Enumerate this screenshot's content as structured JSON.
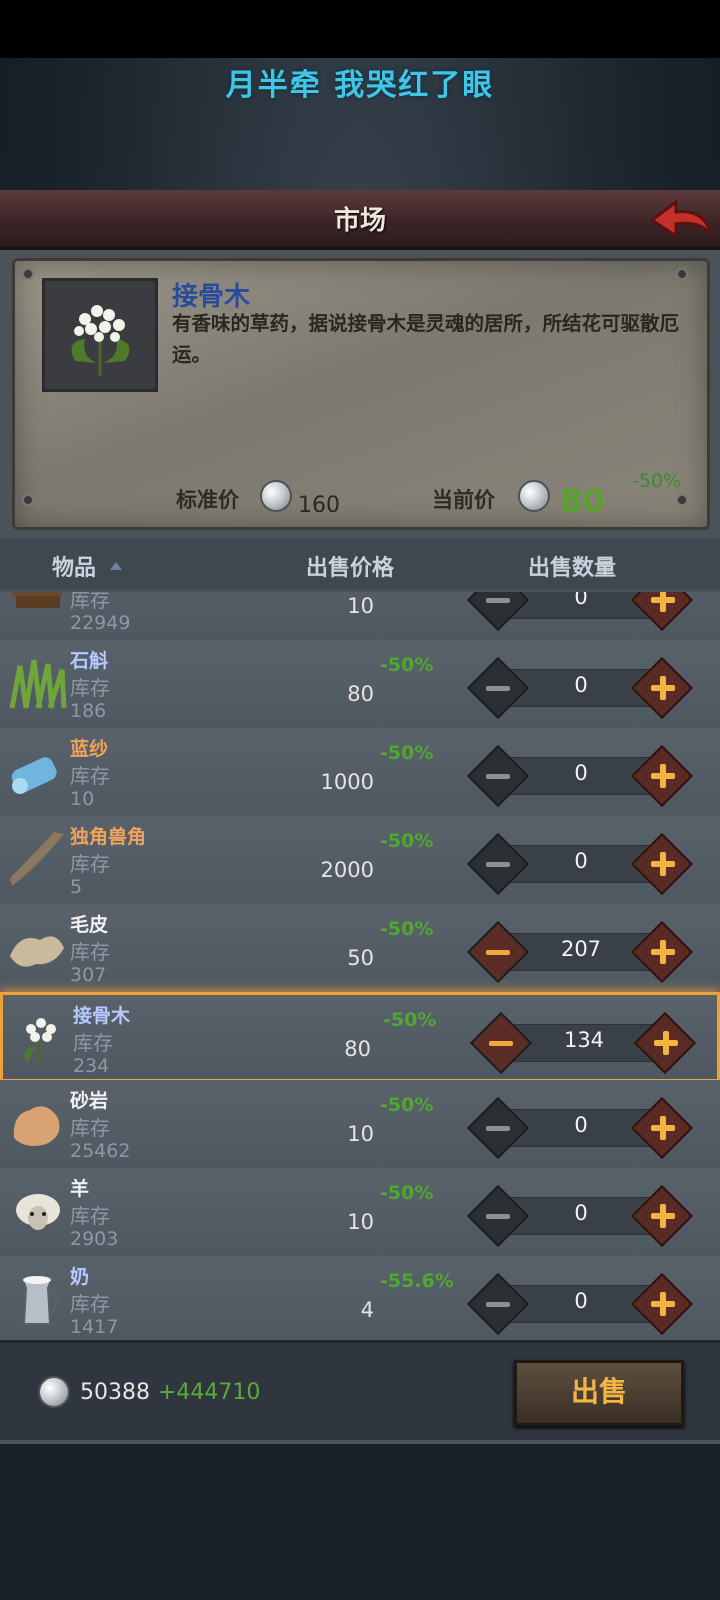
{
  "banner": {
    "text": "月半牵 我哭红了眼"
  },
  "header": {
    "title": "市场"
  },
  "detail": {
    "name": "接骨木",
    "description": "有香味的草药，据说接骨木是灵魂的居所，所结花可驱散厄运。",
    "standard_price_label": "标准价",
    "standard_price": "160",
    "current_price_label": "当前价",
    "current_price": "80",
    "discount": "-50%"
  },
  "columns": {
    "item": "物品",
    "price": "出售价格",
    "quantity": "出售数量"
  },
  "rows": [
    {
      "name": "",
      "stock_label": "库存",
      "stock": "22949",
      "discount": "",
      "price": "10",
      "qty": "0",
      "name_color": "#b6c9ff",
      "icon": "wood-icon",
      "selected": false,
      "active": false
    },
    {
      "name": "石斛",
      "stock_label": "库存",
      "stock": "186",
      "discount": "-50%",
      "price": "80",
      "qty": "0",
      "name_color": "#b6c9ff",
      "icon": "grass-icon",
      "selected": false,
      "active": false
    },
    {
      "name": "蓝纱",
      "stock_label": "库存",
      "stock": "10",
      "discount": "-50%",
      "price": "1000",
      "qty": "0",
      "name_color": "#f0a35a",
      "icon": "cloth-roll-icon",
      "selected": false,
      "active": false
    },
    {
      "name": "独角兽角",
      "stock_label": "库存",
      "stock": "5",
      "discount": "-50%",
      "price": "2000",
      "qty": "0",
      "name_color": "#f0a35a",
      "icon": "horn-icon",
      "selected": false,
      "active": false
    },
    {
      "name": "毛皮",
      "stock_label": "库存",
      "stock": "307",
      "discount": "-50%",
      "price": "50",
      "qty": "207",
      "name_color": "#f2f2f2",
      "icon": "fur-icon",
      "selected": false,
      "active": true
    },
    {
      "name": "接骨木",
      "stock_label": "库存",
      "stock": "234",
      "discount": "-50%",
      "price": "80",
      "qty": "134",
      "name_color": "#b6c9ff",
      "icon": "elder-flower-icon",
      "selected": true,
      "active": true
    },
    {
      "name": "砂岩",
      "stock_label": "库存",
      "stock": "25462",
      "discount": "-50%",
      "price": "10",
      "qty": "0",
      "name_color": "#f2f2f2",
      "icon": "sandstone-icon",
      "selected": false,
      "active": false
    },
    {
      "name": "羊",
      "stock_label": "库存",
      "stock": "2903",
      "discount": "-50%",
      "price": "10",
      "qty": "0",
      "name_color": "#f2f2f2",
      "icon": "sheep-icon",
      "selected": false,
      "active": false
    },
    {
      "name": "奶",
      "stock_label": "库存",
      "stock": "1417",
      "discount": "-55.6%",
      "price": "4",
      "qty": "0",
      "name_color": "#b6c9ff",
      "icon": "milk-jug-icon",
      "selected": false,
      "active": false
    }
  ],
  "footer": {
    "money": "50388",
    "gain": "+444710",
    "sell_label": "出售"
  }
}
